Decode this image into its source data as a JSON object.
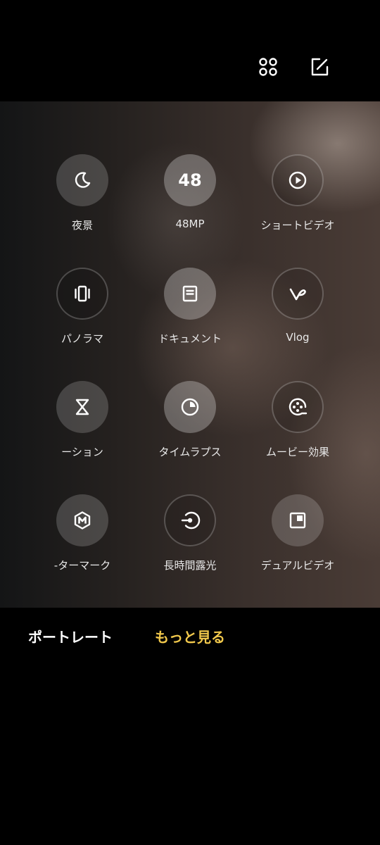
{
  "header": {
    "icons": [
      "grid-icon",
      "edit-icon"
    ]
  },
  "modes": [
    {
      "label": "夜景",
      "icon": "moon-icon"
    },
    {
      "label": "48MP",
      "icon": "48-icon",
      "icon_text": "48"
    },
    {
      "label": "ショートビデオ",
      "icon": "play-icon"
    },
    {
      "label": "パノラマ",
      "icon": "panorama-icon"
    },
    {
      "label": "ドキュメント",
      "icon": "document-icon"
    },
    {
      "label": "Vlog",
      "icon": "vlog-icon"
    },
    {
      "label": "ーション",
      "icon": "hourglass-icon"
    },
    {
      "label": "タイムラプス",
      "icon": "timelapse-icon"
    },
    {
      "label": "ムービー効果",
      "icon": "film-reel-icon"
    },
    {
      "label": "-ターマーク",
      "icon": "watermark-icon"
    },
    {
      "label": "長時間露光",
      "icon": "long-exposure-icon"
    },
    {
      "label": "デュアルビデオ",
      "icon": "dual-video-icon"
    }
  ],
  "bottom_bar": {
    "portrait": "ポートレート",
    "more": "もっと見る"
  },
  "colors": {
    "accent": "#f2c94c",
    "background": "#000000"
  }
}
